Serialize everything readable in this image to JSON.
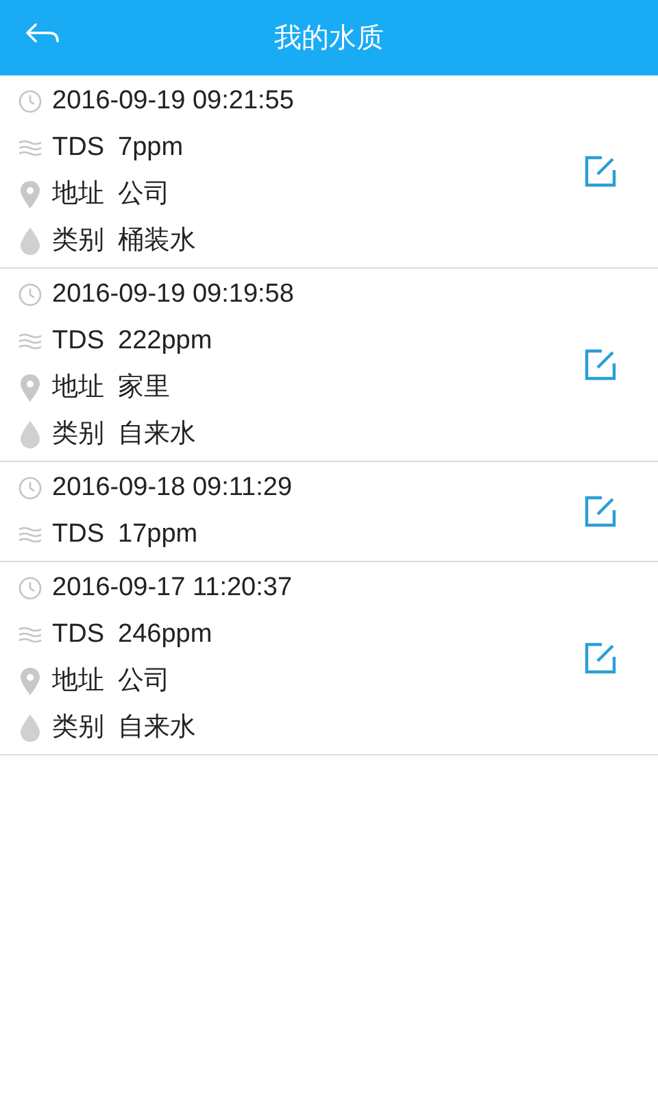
{
  "header": {
    "title": "我的水质"
  },
  "records": [
    {
      "time": "2016-09-19 09:21:55",
      "fields": [
        {
          "kind": "tds",
          "label": "TDS",
          "value": "7ppm"
        },
        {
          "kind": "address",
          "label": "地址",
          "value": "公司"
        },
        {
          "kind": "category",
          "label": "类别",
          "value": "桶装水"
        }
      ]
    },
    {
      "time": "2016-09-19 09:19:58",
      "fields": [
        {
          "kind": "tds",
          "label": "TDS",
          "value": "222ppm"
        },
        {
          "kind": "address",
          "label": "地址",
          "value": "家里"
        },
        {
          "kind": "category",
          "label": "类别",
          "value": "自来水"
        }
      ]
    },
    {
      "time": "2016-09-18 09:11:29",
      "fields": [
        {
          "kind": "tds",
          "label": "TDS",
          "value": "17ppm"
        }
      ]
    },
    {
      "time": "2016-09-17 11:20:37",
      "fields": [
        {
          "kind": "tds",
          "label": "TDS",
          "value": "246ppm"
        },
        {
          "kind": "address",
          "label": "地址",
          "value": "公司"
        },
        {
          "kind": "category",
          "label": "类别",
          "value": "自来水"
        }
      ]
    }
  ]
}
